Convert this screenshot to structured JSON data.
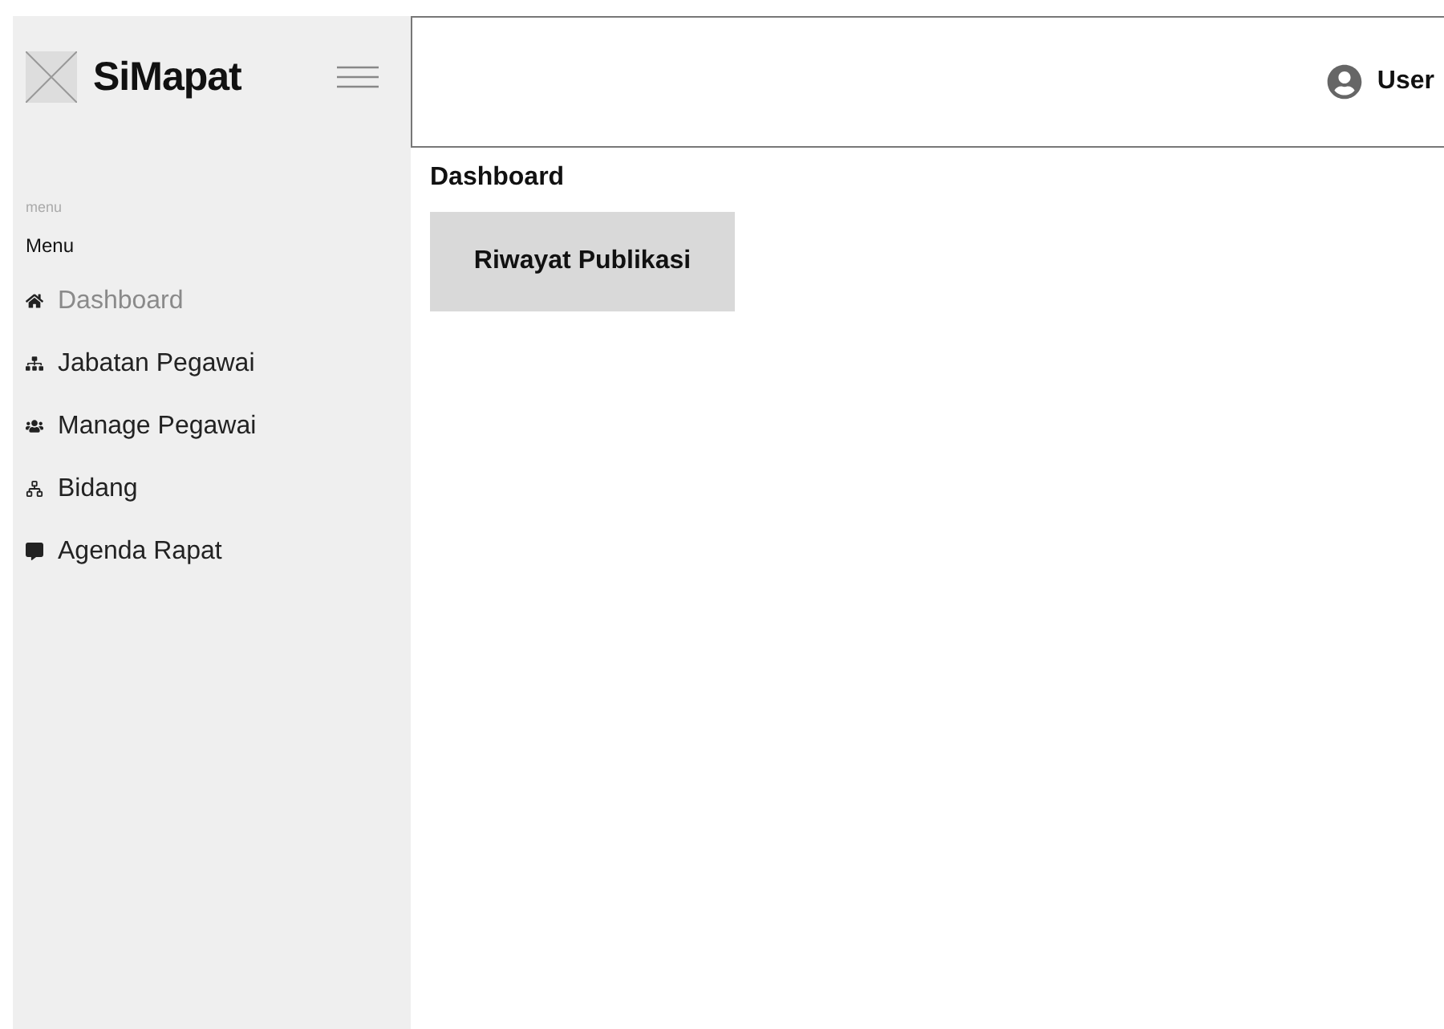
{
  "sidebar": {
    "brand": "SiMapat",
    "section_caption": "menu",
    "section_title": "Menu",
    "items": [
      {
        "label": "Dashboard",
        "selected": true
      },
      {
        "label": "Jabatan Pegawai",
        "selected": false
      },
      {
        "label": "Manage Pegawai",
        "selected": false
      },
      {
        "label": "Bidang",
        "selected": false
      },
      {
        "label": "Agenda Rapat",
        "selected": false
      }
    ]
  },
  "header": {
    "user": "User"
  },
  "page": {
    "title": "Dashboard",
    "cards": [
      "Riwayat Publikasi"
    ]
  }
}
